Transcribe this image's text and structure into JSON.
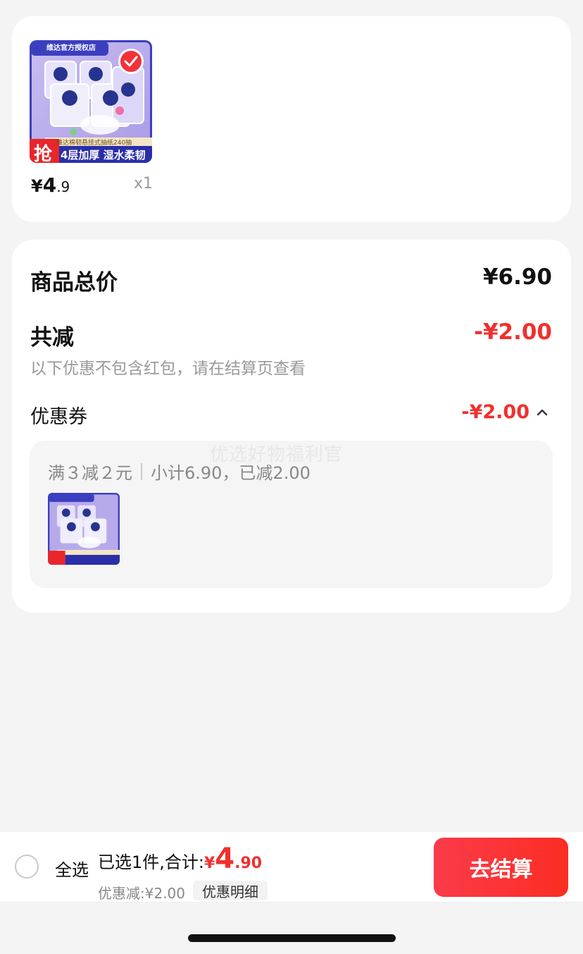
{
  "product": {
    "image_store_text": "维达官方授权店",
    "image_banner_text": "维达棉韧悬挂式抽纸240抽",
    "image_badge": "抢",
    "image_tagline": "4层加厚 湿水柔韧",
    "price_currency": "¥",
    "price_int": "4",
    "price_dec": ".9",
    "quantity": "x1",
    "selected": true
  },
  "summary": {
    "total_label": "商品总价",
    "total_value": "¥6.90",
    "reduce_label": "共减",
    "reduce_value": "-¥2.00",
    "note": "以下优惠不包含红包，请在结算页查看",
    "coupon_label": "优惠券",
    "coupon_value": "-¥2.00",
    "coupon_rule": "满３减２元",
    "coupon_subtotal": "小计6.90，已减2.00",
    "watermark": "优选好物福利官"
  },
  "bottom_bar": {
    "select_all": "全选",
    "selected_text": "已选1件,合计:",
    "total_currency": "¥",
    "total_int": "4",
    "total_dec": ".90",
    "discount_text": "优惠减:¥2.00",
    "detail_button": "优惠明细",
    "checkout_button": "去结算"
  },
  "colors": {
    "accent": "#f0302e",
    "card_bg": "#ffffff",
    "page_bg": "#f4f4f4"
  }
}
